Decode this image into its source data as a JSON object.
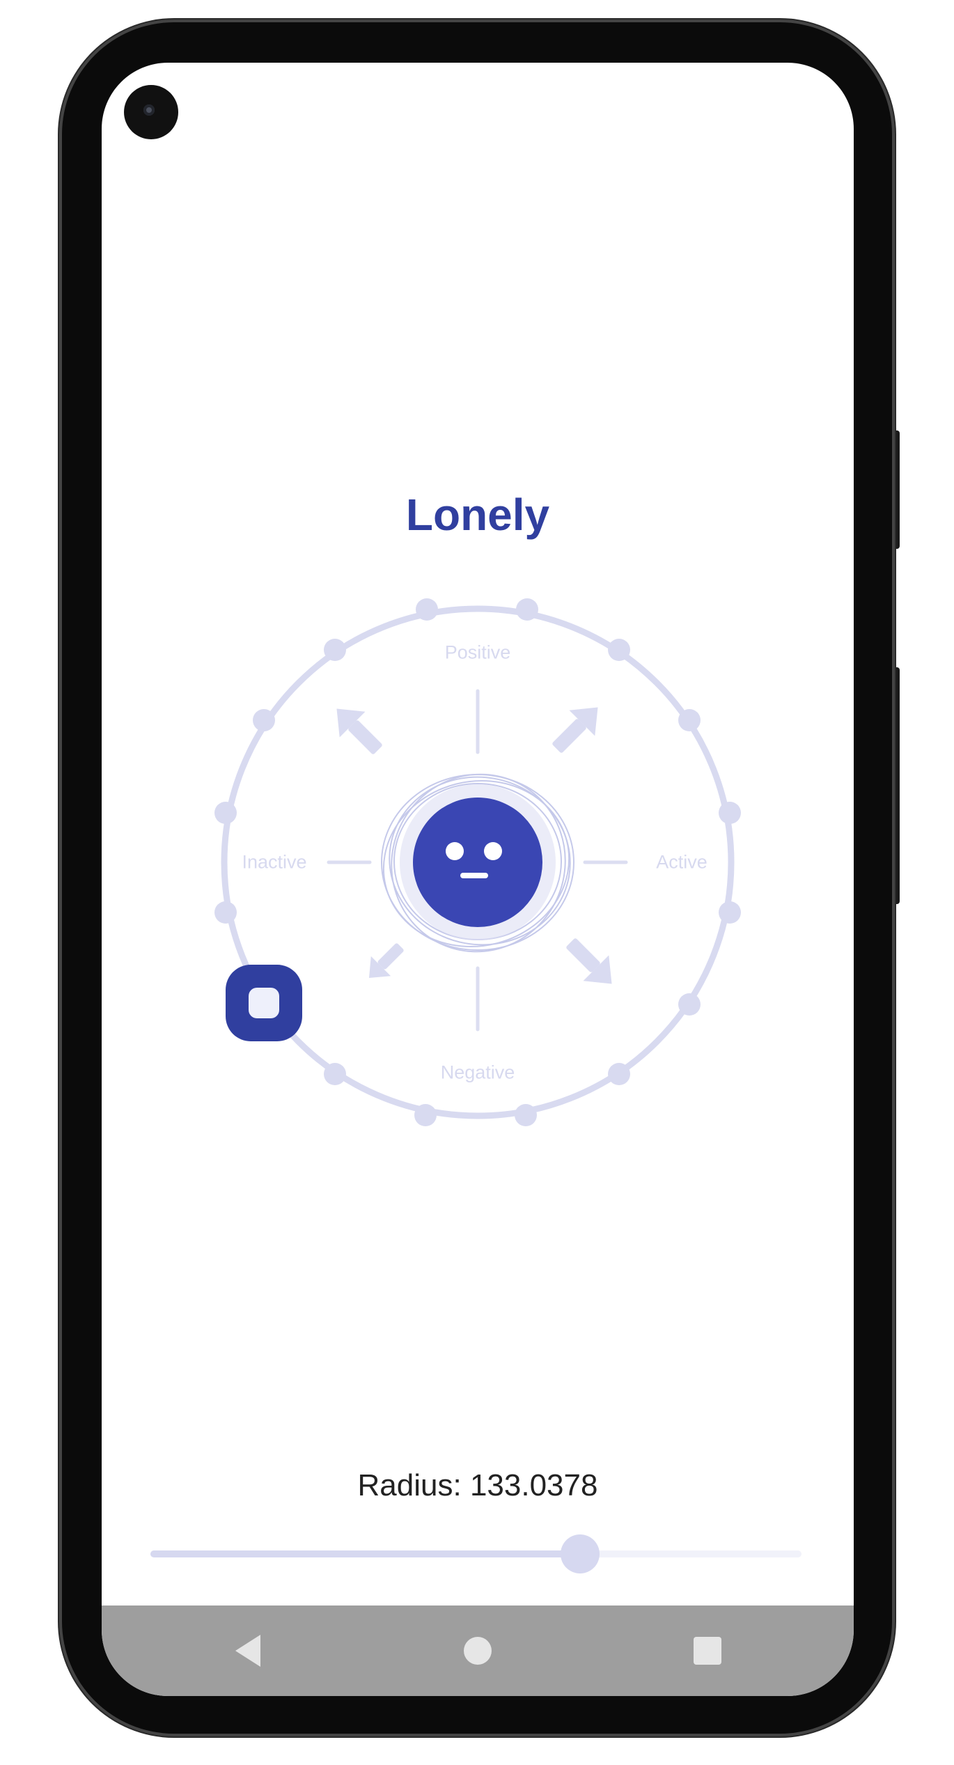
{
  "mood": {
    "title": "Lonely",
    "accent_color": "#303f9f",
    "face_icon": "neutral-face-icon"
  },
  "wheel": {
    "labels": {
      "positive": "Positive",
      "negative": "Negative",
      "inactive": "Inactive",
      "active": "Active"
    }
  },
  "radius": {
    "text": "Radius: 133.0378",
    "slider_fraction": 0.66
  },
  "nav": {
    "back_icon": "back-triangle-icon",
    "home_icon": "home-circle-icon",
    "recent_icon": "recent-square-icon"
  }
}
